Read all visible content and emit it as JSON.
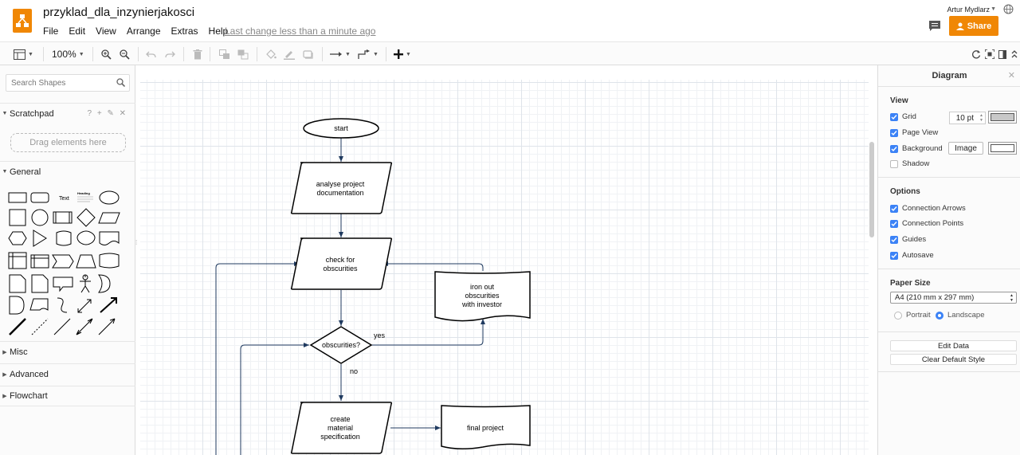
{
  "header": {
    "title": "przyklad_dla_inzynierjakosci",
    "menu": [
      "File",
      "Edit",
      "View",
      "Arrange",
      "Extras",
      "Help"
    ],
    "last_change": "Last change less than a minute ago",
    "user": "Artur Mydlarz",
    "share_label": "Share",
    "brand_color": "#f08705"
  },
  "toolbar": {
    "zoom": "100%"
  },
  "sidebar": {
    "search_placeholder": "Search Shapes",
    "scratchpad_label": "Scratchpad",
    "scratchpad_tools": "? + ✎ ✕",
    "drag_hint": "Drag elements here",
    "general_label": "General",
    "shape_text_label": "Text",
    "shape_heading_label": "Heading",
    "sections": [
      "Misc",
      "Advanced",
      "Flowchart"
    ]
  },
  "diagram": {
    "nodes": {
      "start": "start",
      "analyse_line1": "analyse project",
      "analyse_line2": "documentation",
      "check_line1": "check for",
      "check_line2": "obscurities",
      "decision": "obscurities?",
      "iron_line1": "iron out",
      "iron_line2": "obscurities",
      "iron_line3": "with investor",
      "create_line1": "create",
      "create_line2": "material",
      "create_line3": "specification",
      "final": "final project"
    },
    "edge_labels": {
      "yes": "yes",
      "no": "no"
    }
  },
  "format_panel": {
    "title": "Diagram",
    "view_header": "View",
    "grid_label": "Grid",
    "grid_size": "10 pt",
    "page_view_label": "Page View",
    "background_label": "Background",
    "image_button": "Image",
    "shadow_label": "Shadow",
    "options_header": "Options",
    "connection_arrows_label": "Connection Arrows",
    "connection_points_label": "Connection Points",
    "guides_label": "Guides",
    "autosave_label": "Autosave",
    "paper_size_header": "Paper Size",
    "paper_size_value": "A4 (210 mm x 297 mm)",
    "portrait_label": "Portrait",
    "landscape_label": "Landscape",
    "edit_data_button": "Edit Data",
    "clear_style_button": "Clear Default Style",
    "checkbox_color": "#3b82f6"
  }
}
